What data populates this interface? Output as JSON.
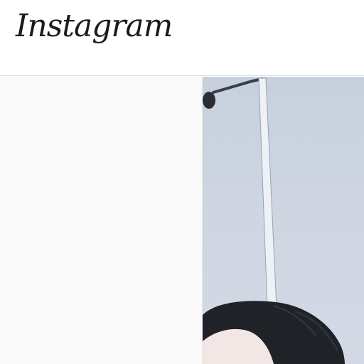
{
  "header": {
    "logo_text": "Instagram"
  },
  "colors": {
    "header_bg": "#ffffff",
    "left_pane_bg": "#fafafa",
    "sky": "#cfd6e2",
    "lamp_post": "#e7ebf0",
    "hair": "#1f2227",
    "skin": "#f2e7e4"
  },
  "photo": {
    "subject_icons": [
      "street-lamp-icon",
      "person-head-icon"
    ]
  }
}
